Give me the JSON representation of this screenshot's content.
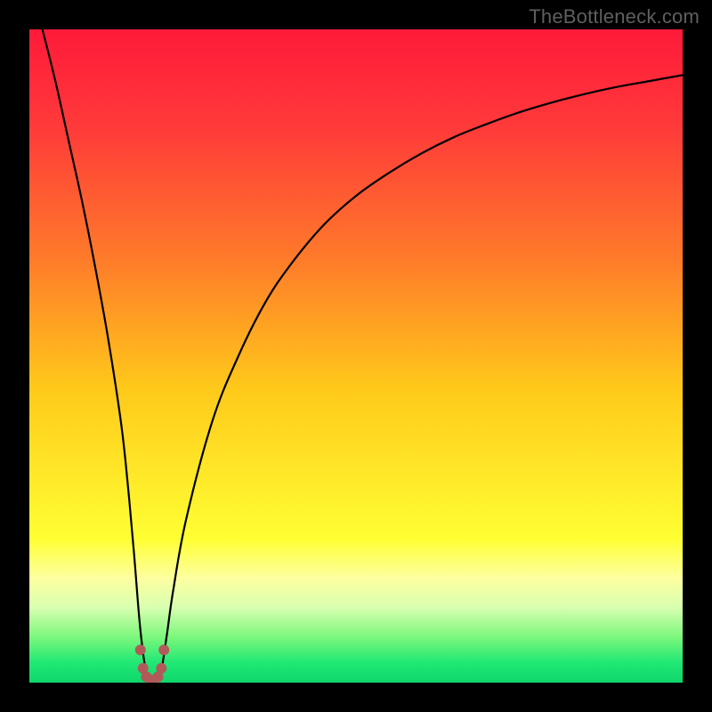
{
  "attribution": "TheBottleneck.com",
  "colors": {
    "frame": "#000000",
    "gradient_stops": [
      {
        "offset": 0.0,
        "color": "#ff1a3a"
      },
      {
        "offset": 0.15,
        "color": "#ff3a3a"
      },
      {
        "offset": 0.35,
        "color": "#ff7a2a"
      },
      {
        "offset": 0.55,
        "color": "#ffc91a"
      },
      {
        "offset": 0.78,
        "color": "#ffff33"
      },
      {
        "offset": 0.84,
        "color": "#fdffa0"
      },
      {
        "offset": 0.885,
        "color": "#d8ffb0"
      },
      {
        "offset": 0.93,
        "color": "#7cf77c"
      },
      {
        "offset": 0.97,
        "color": "#1fe874"
      },
      {
        "offset": 1.0,
        "color": "#0fd66a"
      }
    ],
    "curve": "#000000",
    "markers": "#b25a5a"
  },
  "chart_data": {
    "type": "line",
    "title": "",
    "xlabel": "",
    "ylabel": "",
    "xlim": [
      0,
      100
    ],
    "ylim": [
      0,
      100
    ],
    "series": [
      {
        "name": "bottleneck-curve",
        "x": [
          2,
          4,
          6,
          8,
          10,
          12,
          14,
          15,
          16,
          17,
          18,
          19,
          20,
          21,
          22,
          24,
          28,
          32,
          36,
          40,
          45,
          50,
          55,
          60,
          65,
          70,
          75,
          80,
          85,
          90,
          95,
          100
        ],
        "y": [
          100,
          92,
          83,
          74,
          64,
          53,
          40,
          31,
          20,
          8,
          1,
          0.5,
          1,
          7,
          14,
          25,
          40,
          50,
          58,
          64,
          70,
          74.5,
          78,
          81,
          83.5,
          85.5,
          87.3,
          88.8,
          90.1,
          91.2,
          92.1,
          93
        ]
      }
    ],
    "markers": [
      {
        "x": 17.0,
        "y": 5.0
      },
      {
        "x": 17.4,
        "y": 2.2
      },
      {
        "x": 17.9,
        "y": 0.9
      },
      {
        "x": 18.5,
        "y": 0.4
      },
      {
        "x": 19.1,
        "y": 0.4
      },
      {
        "x": 19.7,
        "y": 0.9
      },
      {
        "x": 20.2,
        "y": 2.2
      },
      {
        "x": 20.6,
        "y": 5.0
      }
    ],
    "marker_radius_px": 6
  }
}
